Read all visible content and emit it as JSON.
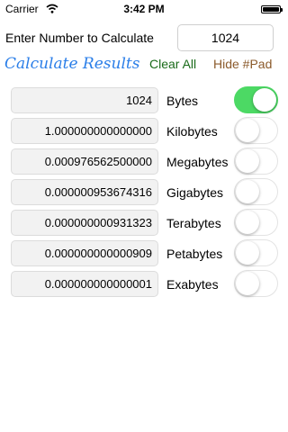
{
  "status_bar": {
    "carrier": "Carrier",
    "time": "3:42 PM"
  },
  "prompt_label": "Enter Number to Calculate",
  "number_input": {
    "value": "1024"
  },
  "buttons": {
    "calculate": "Calculate Results",
    "clear": "Clear All",
    "hide_keypad": "Hide #Pad"
  },
  "colors": {
    "calculate": "#2a7ee8",
    "clear": "#1a6b1a",
    "hide_keypad": "#8b5a2b",
    "toggle_on": "#4cd964"
  },
  "results": [
    {
      "value": "1024",
      "unit": "Bytes",
      "toggle_on": true
    },
    {
      "value": "1.000000000000000",
      "unit": "Kilobytes",
      "toggle_on": false
    },
    {
      "value": "0.000976562500000",
      "unit": "Megabytes",
      "toggle_on": false
    },
    {
      "value": "0.000000953674316",
      "unit": "Gigabytes",
      "toggle_on": false
    },
    {
      "value": "0.000000000931323",
      "unit": "Terabytes",
      "toggle_on": false
    },
    {
      "value": "0.000000000000909",
      "unit": "Petabytes",
      "toggle_on": false
    },
    {
      "value": "0.000000000000001",
      "unit": "Exabytes",
      "toggle_on": false
    }
  ]
}
